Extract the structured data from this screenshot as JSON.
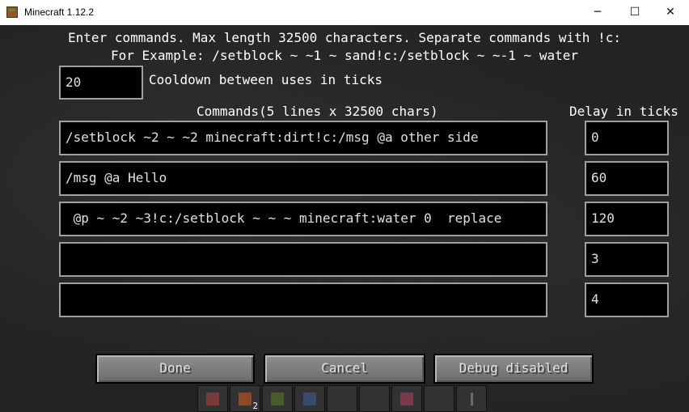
{
  "window": {
    "title": "Minecraft 1.12.2",
    "min_glyph": "─",
    "max_glyph": "☐",
    "close_glyph": "✕"
  },
  "instructions": {
    "line1": "Enter commands. Max length 32500 characters. Separate commands with !c:",
    "line2": "For Example: /setblock ~ ~1 ~ sand!c:/setblock ~ ~-1 ~ water"
  },
  "cooldown": {
    "value": "20",
    "label": "Cooldown between uses in ticks"
  },
  "headers": {
    "commands": "Commands(5 lines x 32500 chars)",
    "delay": "Delay in ticks"
  },
  "commands": [
    {
      "command": "/setblock ~2 ~ ~2 minecraft:dirt!c:/msg @a other side",
      "delay": "0"
    },
    {
      "command": "/msg @a Hello",
      "delay": "60"
    },
    {
      "command": " @p ~ ~2 ~3!c:/setblock ~ ~ ~ minecraft:water 0  replace",
      "delay": "120"
    },
    {
      "command": "",
      "delay": "3"
    },
    {
      "command": "",
      "delay": "4"
    }
  ],
  "buttons": {
    "done": "Done",
    "cancel": "Cancel",
    "debug": "Debug disabled"
  },
  "hotbar": {
    "slot2_count": "2"
  }
}
